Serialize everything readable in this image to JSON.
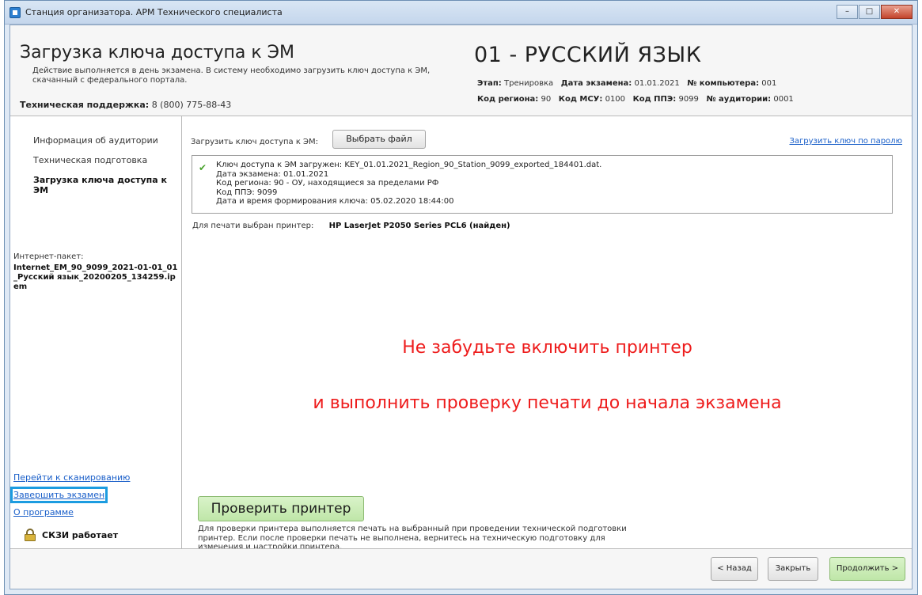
{
  "window": {
    "title": "Станция организатора. АРМ Технического специалиста"
  },
  "header": {
    "title": "Загрузка ключа доступа к ЭМ",
    "description": "Действие выполняется в день экзамена. В систему необходимо загрузить ключ доступа к ЭМ, скачанный с федерального портала.",
    "support_label": "Техническая поддержка:",
    "support_phone": "8 (800) 775-88-43",
    "subject": "01 - РУССКИЙ ЯЗЫК",
    "stage_label": "Этап:",
    "stage_value": "Тренировка",
    "exam_date_label": "Дата экзамена:",
    "exam_date_value": "01.01.2021",
    "computer_label": "№ компьютера:",
    "computer_value": "001",
    "region_label": "Код региона:",
    "region_value": "90",
    "msu_label": "Код МСУ:",
    "msu_value": "0100",
    "ppe_label": "Код ППЭ:",
    "ppe_value": "9099",
    "auditorium_label": "№ аудитории:",
    "auditorium_value": "0001"
  },
  "sidebar": {
    "items": [
      {
        "label": "Информация об аудитории",
        "active": false
      },
      {
        "label": "Техническая подготовка",
        "active": false
      },
      {
        "label": "Загрузка ключа доступа к ЭМ",
        "active": true
      }
    ],
    "package_label": "Интернет-пакет:",
    "package_value": "Internet_EM_90_9099_2021-01-01_01_Русский язык_20200205_134259.ipem",
    "links": {
      "scan": "Перейти к сканированию",
      "finish": "Завершить экзамен",
      "about": "О программе"
    },
    "skzi_status": "СКЗИ работает"
  },
  "main": {
    "load_key_label": "Загрузить ключ доступа к ЭМ:",
    "choose_file_button": "Выбрать файл",
    "password_link": "Загрузить ключ по паролю",
    "key_info": {
      "line1": "Ключ доступа к ЭМ загружен: KEY_01.01.2021_Region_90_Station_9099_exported_184401.dat.",
      "line2": "Дата экзамена: 01.01.2021",
      "line3": "Код региона: 90 - ОУ, находящиеся за пределами РФ",
      "line4": "Код ППЭ: 9099",
      "line5": "Дата и время формирования ключа: 05.02.2020 18:44:00"
    },
    "printer_label": "Для печати выбран принтер:",
    "printer_value": "HP LaserJet P2050 Series PCL6 (найден)",
    "warning_line1": "Не забудьте включить принтер",
    "warning_line2": "и выполнить проверку печати до начала экзамена",
    "check_printer_button": "Проверить принтер",
    "check_printer_note": "Для проверки принтера выполняется печать на выбранный при проведении технической подготовки принтер. Если после проверки печать не выполнена, вернитесь на техническую подготовку для изменения и настройки принтера."
  },
  "footer": {
    "back_button": "< Назад",
    "close_button": "Закрыть",
    "next_button": "Продолжить >"
  },
  "colors": {
    "warning": "#ee1c1c",
    "link": "#1a5fc9",
    "highlight": "#1c9ce0",
    "green_button": "#c8ebb3"
  }
}
